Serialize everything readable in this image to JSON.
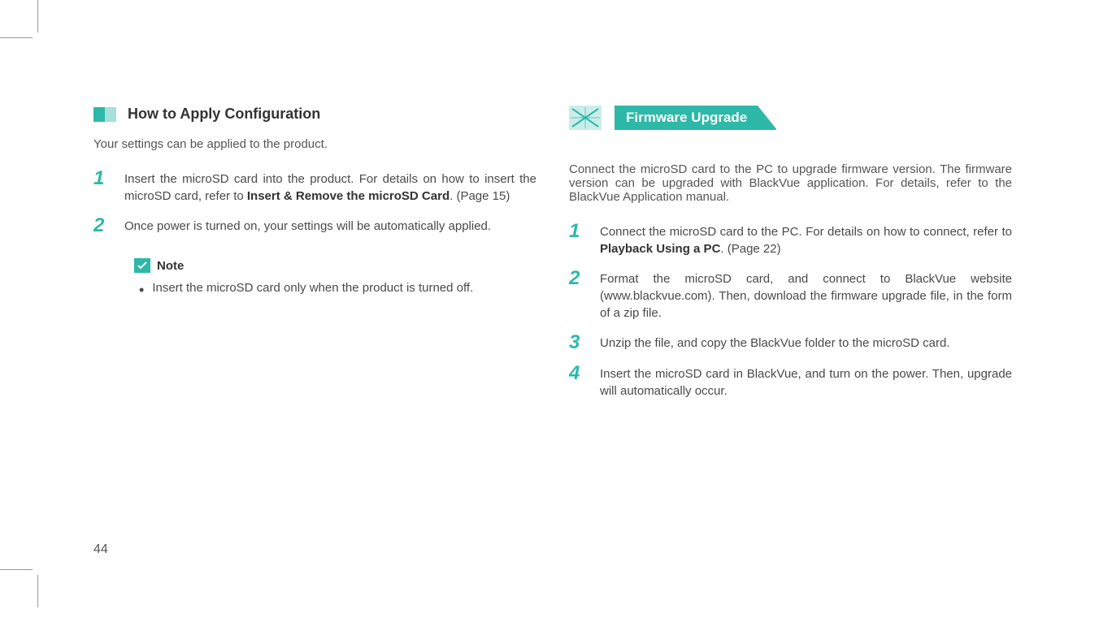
{
  "left": {
    "heading": "How to Apply Configuration",
    "intro": "Your settings can be applied to the product.",
    "steps": [
      {
        "num": "1",
        "text": "Insert the microSD card into the product. For details on how to insert the microSD card, refer to ",
        "bold": "Insert & Remove the microSD Card",
        "suffix": ". (Page 15)"
      },
      {
        "num": "2",
        "text": "Once power is turned on, your settings will be automatically applied.",
        "bold": "",
        "suffix": ""
      }
    ],
    "note": {
      "label": "Note",
      "items": [
        "Insert the microSD card only when the product is turned off."
      ]
    }
  },
  "right": {
    "heading": "Firmware Upgrade",
    "intro": "Connect the microSD card to the PC to upgrade firmware version. The firmware version can be upgraded with BlackVue application. For details, refer to the BlackVue Application manual.",
    "steps": [
      {
        "num": "1",
        "text": "Connect the microSD card to the PC. For details on how to connect, refer to ",
        "bold": "Playback Using a PC",
        "suffix": ". (Page 22)"
      },
      {
        "num": "2",
        "text": "Format the microSD card, and connect to BlackVue website (www.blackvue.com). Then, download the firmware upgrade file, in the form of a zip file.",
        "bold": "",
        "suffix": ""
      },
      {
        "num": "3",
        "text": "Unzip the file, and copy the BlackVue folder to the microSD card.",
        "bold": "",
        "suffix": ""
      },
      {
        "num": "4",
        "text": "Insert the microSD card in BlackVue, and turn on the power. Then, upgrade will automatically occur.",
        "bold": "",
        "suffix": ""
      }
    ]
  },
  "pageNumber": "44"
}
